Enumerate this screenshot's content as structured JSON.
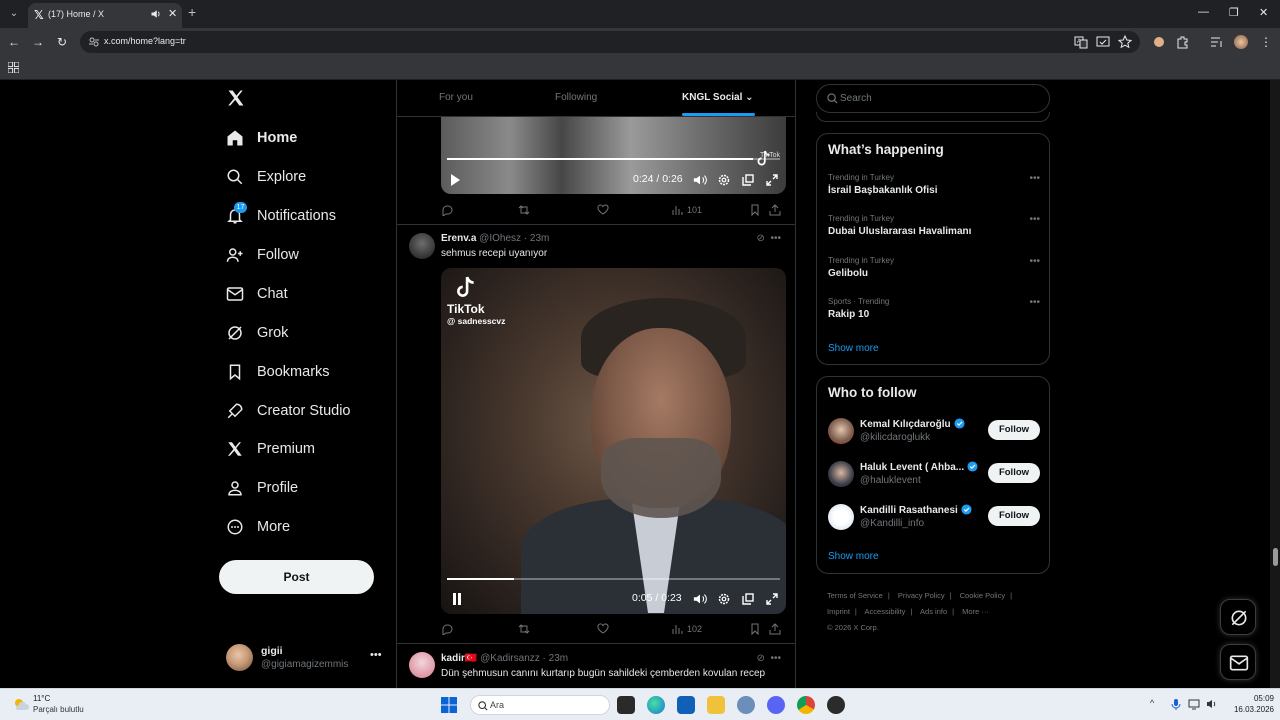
{
  "browser": {
    "tab_title": "(17) Home / X",
    "url": "x.com/home?lang=tr"
  },
  "nav": {
    "items": [
      {
        "label": "Home",
        "icon": "home-icon",
        "active": true
      },
      {
        "label": "Explore",
        "icon": "search-icon"
      },
      {
        "label": "Notifications",
        "icon": "bell-icon",
        "badge": "17"
      },
      {
        "label": "Follow",
        "icon": "person-plus-icon"
      },
      {
        "label": "Chat",
        "icon": "mail-icon"
      },
      {
        "label": "Grok",
        "icon": "grok-icon"
      },
      {
        "label": "Bookmarks",
        "icon": "bookmark-icon"
      },
      {
        "label": "Creator Studio",
        "icon": "rocket-icon"
      },
      {
        "label": "Premium",
        "icon": "x-icon"
      },
      {
        "label": "Profile",
        "icon": "person-icon"
      },
      {
        "label": "More",
        "icon": "more-circle-icon"
      }
    ],
    "post_button": "Post"
  },
  "account": {
    "name": "gigii",
    "handle": "@gigiamagizemmis"
  },
  "feed": {
    "tabs": [
      "For you",
      "Following",
      "KNGL Social"
    ],
    "active_tab": "KNGL Social"
  },
  "post1": {
    "video_time": "0:24 / 0:26",
    "progress": 0.92,
    "tiktok_small": "TikTok",
    "views": "101"
  },
  "post2": {
    "name": "Erenv.a",
    "handle": "@IOhesz",
    "time": "23m",
    "text": "sehmus recepi uyanıyor",
    "tiktok_brand": "TikTok",
    "tiktok_user": "@ sadnesscvz",
    "video_time": "0:05 / 0:23",
    "progress": 0.2,
    "views": "102"
  },
  "post3": {
    "name": "kadir",
    "flag": "🇹🇷",
    "handle": "@Kadirsanzz",
    "time": "23m",
    "text": "Dün şehmusun canını kurtarıp bugün sahildeki çemberden kovulan recep"
  },
  "search": {
    "placeholder": "Search"
  },
  "trends": {
    "title": "What’s happening",
    "items": [
      {
        "context": "Trending in Turkey",
        "title": "İsrail Başbakanlık Ofisi"
      },
      {
        "context": "Trending in Turkey",
        "title": "Dubai Uluslararası Havalimanı"
      },
      {
        "context": "Trending in Turkey",
        "title": "Gelibolu"
      },
      {
        "context": "Sports · Trending",
        "title": "Rakip 10"
      }
    ],
    "show_more": "Show more"
  },
  "who_to_follow": {
    "title": "Who to follow",
    "users": [
      {
        "name": "Kemal Kılıçdaroğlu",
        "handle": "@kilicdaroglukk",
        "button": "Follow"
      },
      {
        "name": "Haluk Levent ( Ahba...",
        "handle": "@haluklevent",
        "button": "Follow"
      },
      {
        "name": "Kandilli Rasathanesi",
        "handle": "@Kandilli_info",
        "button": "Follow"
      }
    ],
    "show_more": "Show more"
  },
  "footer": {
    "links": [
      "Terms of Service",
      "Privacy Policy",
      "Cookie Policy",
      "Imprint",
      "Accessibility",
      "Ads info",
      "More ···"
    ],
    "copyright": "© 2026 X Corp."
  },
  "taskbar": {
    "weather_temp": "11°C",
    "weather_desc": "Parçalı bulutlu",
    "search_placeholder": "Ara",
    "time": "05:09",
    "date": "16.03.2026"
  },
  "colors": {
    "accent": "#1d9bf0",
    "background": "#000000",
    "text": "#e7e9ea",
    "muted": "#71767b",
    "border": "#2f3336"
  }
}
